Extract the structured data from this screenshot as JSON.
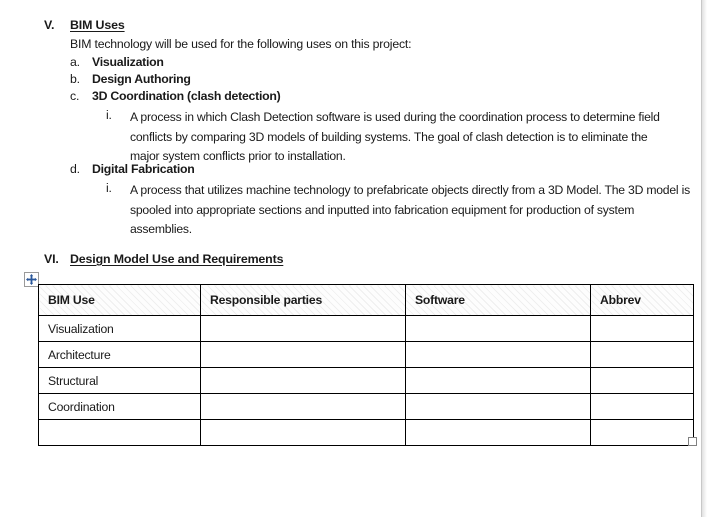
{
  "document": {
    "sections": [
      {
        "number": "V.",
        "title": "BIM Uses",
        "intro": "BIM technology will be used for the following uses on this project:",
        "items": [
          {
            "marker": "a.",
            "label": "Visualization",
            "sub": []
          },
          {
            "marker": "b.",
            "label": "Design Authoring",
            "sub": []
          },
          {
            "marker": "c.",
            "label": "3D Coordination (clash detection)",
            "sub": [
              {
                "marker": "i.",
                "text": "A process in which Clash Detection software is used during the coordination process to determine field conflicts by comparing 3D models of building systems. The goal of clash detection is to eliminate the major system conflicts prior to installation."
              }
            ]
          },
          {
            "marker": "d.",
            "label": "Digital Fabrication",
            "sub": [
              {
                "marker": "i.",
                "text": "A process that utilizes machine technology to prefabricate objects directly from a 3D Model. The 3D model is spooled into appropriate sections and inputted into fabrication equipment for production of system assemblies."
              }
            ]
          }
        ]
      },
      {
        "number": "VI.",
        "title": "Design Model Use and Requirements",
        "intro": "",
        "items": []
      }
    ]
  },
  "table": {
    "headers": [
      "BIM Use",
      "Responsible parties",
      "Software",
      "Abbrev"
    ],
    "rows": [
      [
        "Visualization",
        "",
        "",
        ""
      ],
      [
        "Architecture",
        "",
        "",
        ""
      ],
      [
        "Structural",
        "",
        "",
        ""
      ],
      [
        "Coordination",
        "",
        "",
        ""
      ],
      [
        "",
        "",
        "",
        ""
      ]
    ]
  },
  "handles": {
    "move_icon": "move-cross-icon",
    "resize_icon": "resize-square-icon"
  },
  "colors": {
    "text": "#1a1a1a",
    "table_border": "#000000",
    "header_hatch": "#e8e8e8",
    "move_handle_accent": "#2b579a",
    "resize_handle": "#808080",
    "page_edge": "#c8c8c8"
  }
}
